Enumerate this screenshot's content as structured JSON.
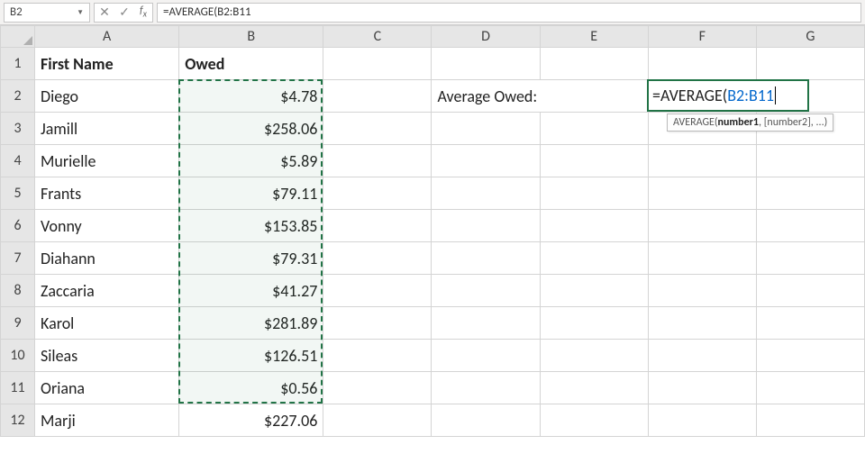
{
  "formula_bar": {
    "cell_ref": "B2",
    "cancel": "✕",
    "confirm": "✓",
    "fx": "fx",
    "formula": "=AVERAGE(B2:B11"
  },
  "columns": [
    "A",
    "B",
    "C",
    "D",
    "E",
    "F",
    "G"
  ],
  "row_numbers": [
    "1",
    "2",
    "3",
    "4",
    "5",
    "6",
    "7",
    "8",
    "9",
    "10",
    "11",
    "12"
  ],
  "headers": {
    "A": "First Name",
    "B": "Owed"
  },
  "rows": [
    {
      "name": "Diego",
      "owed": "$4.78"
    },
    {
      "name": "Jamill",
      "owed": "$258.06"
    },
    {
      "name": "Murielle",
      "owed": "$5.89"
    },
    {
      "name": "Frants",
      "owed": "$79.11"
    },
    {
      "name": "Vonny",
      "owed": "$153.85"
    },
    {
      "name": "Diahann",
      "owed": "$79.31"
    },
    {
      "name": "Zaccaria",
      "owed": "$41.27"
    },
    {
      "name": "Karol",
      "owed": "$281.89"
    },
    {
      "name": "Sileas",
      "owed": "$126.51"
    },
    {
      "name": "Oriana",
      "owed": "$0.56"
    },
    {
      "name": "Marji",
      "owed": "$227.06"
    }
  ],
  "label_cell": "Average Owed:",
  "editing": {
    "prefix": "=AVERAGE(",
    "range": "B2:B11"
  },
  "tooltip_parts": {
    "fn": "AVERAGE(",
    "arg1": "number1",
    "rest": ", [number2], ...)"
  },
  "selection_range": "B2:B11",
  "active_cell": "F2",
  "colors": {
    "accent": "#217346",
    "range_ref": "#0066cc"
  }
}
